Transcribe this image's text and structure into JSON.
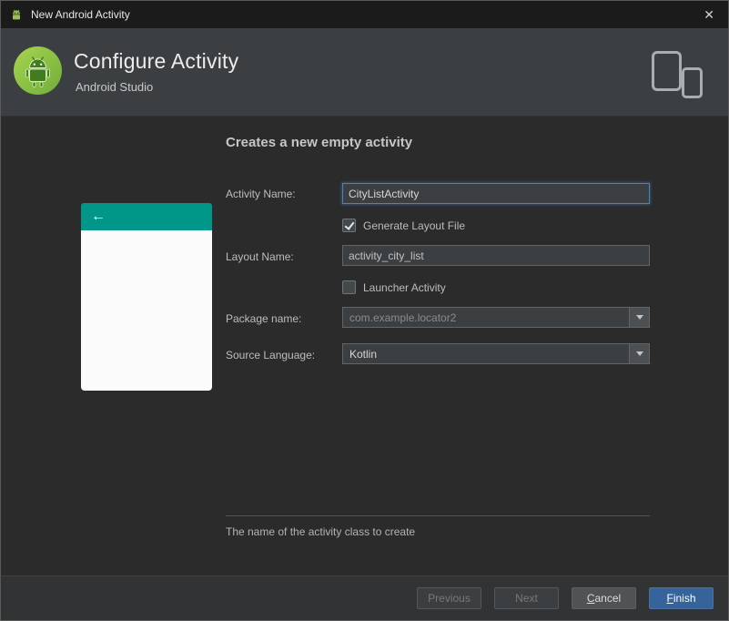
{
  "window": {
    "title": "New Android Activity",
    "icons": {
      "app": "android-icon",
      "close": "✕"
    }
  },
  "header": {
    "title": "Configure Activity",
    "subtitle": "Android Studio"
  },
  "main": {
    "heading": "Creates a new empty activity",
    "hint": "The name of the activity class to create",
    "preview": {
      "back_icon": "←"
    }
  },
  "fields": {
    "activity_name": {
      "label": "Activity Name:",
      "value": "CityListActivity"
    },
    "generate_layout_file": {
      "label": "Generate Layout File",
      "checked": true
    },
    "layout_name": {
      "label": "Layout Name:",
      "value": "activity_city_list"
    },
    "launcher_activity": {
      "label": "Launcher Activity",
      "checked": false
    },
    "package_name": {
      "label": "Package name:",
      "value": "com.example.locator2"
    },
    "source_language": {
      "label": "Source Language:",
      "value": "Kotlin"
    }
  },
  "buttons": {
    "previous": "Previous",
    "next": "Next",
    "cancel": {
      "mnemonic": "C",
      "rest": "ancel"
    },
    "finish": {
      "mnemonic": "F",
      "rest": "inish"
    }
  },
  "colors": {
    "teal": "#009688",
    "focus_blue": "#4a82c3",
    "finish_blue": "#35639a",
    "header_bg": "#3c3f41",
    "main_bg": "#2b2b2b"
  }
}
